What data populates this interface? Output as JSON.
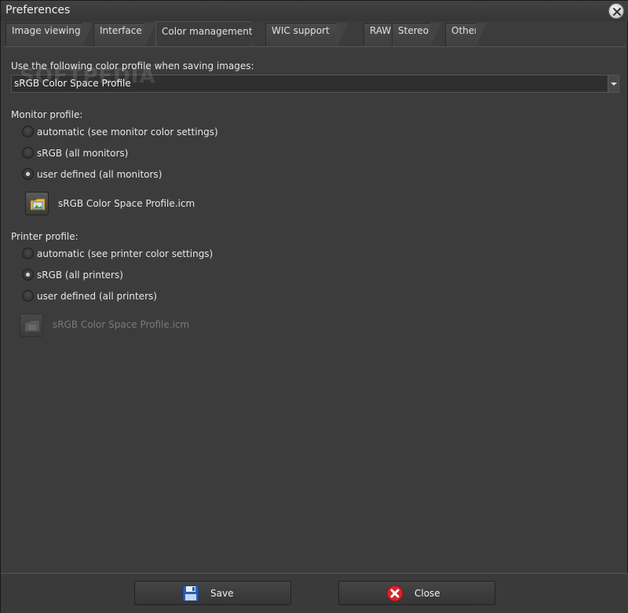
{
  "window": {
    "title": "Preferences"
  },
  "tabs": [
    {
      "label": "Image viewing",
      "active": false
    },
    {
      "label": "Interface",
      "active": false
    },
    {
      "label": "Color management",
      "active": true
    },
    {
      "label": "WIC support",
      "active": false
    },
    {
      "label": "RAW",
      "active": false
    },
    {
      "label": "Stereo",
      "active": false
    },
    {
      "label": "Other",
      "active": false
    }
  ],
  "saving": {
    "label": "Use the following color profile when saving images:",
    "selected": "sRGB Color Space Profile",
    "watermark": "SOFTPEDIA"
  },
  "monitor": {
    "heading": "Monitor profile:",
    "options": [
      {
        "label": "automatic (see monitor color settings)",
        "checked": false
      },
      {
        "label": "sRGB (all monitors)",
        "checked": false
      },
      {
        "label": "user defined (all monitors)",
        "checked": true
      }
    ],
    "file": "sRGB Color Space Profile.icm"
  },
  "printer": {
    "heading": "Printer profile:",
    "options": [
      {
        "label": "automatic (see printer color settings)",
        "checked": false
      },
      {
        "label": "sRGB (all printers)",
        "checked": true
      },
      {
        "label": "user defined (all printers)",
        "checked": false
      }
    ],
    "file": "sRGB Color Space Profile.icm"
  },
  "footer": {
    "save_label": "Save",
    "close_label": "Close"
  },
  "icons": {
    "close": "close-circle-icon",
    "folder": "folder-image-icon",
    "save": "floppy-disk-icon",
    "cancel": "red-x-icon"
  }
}
